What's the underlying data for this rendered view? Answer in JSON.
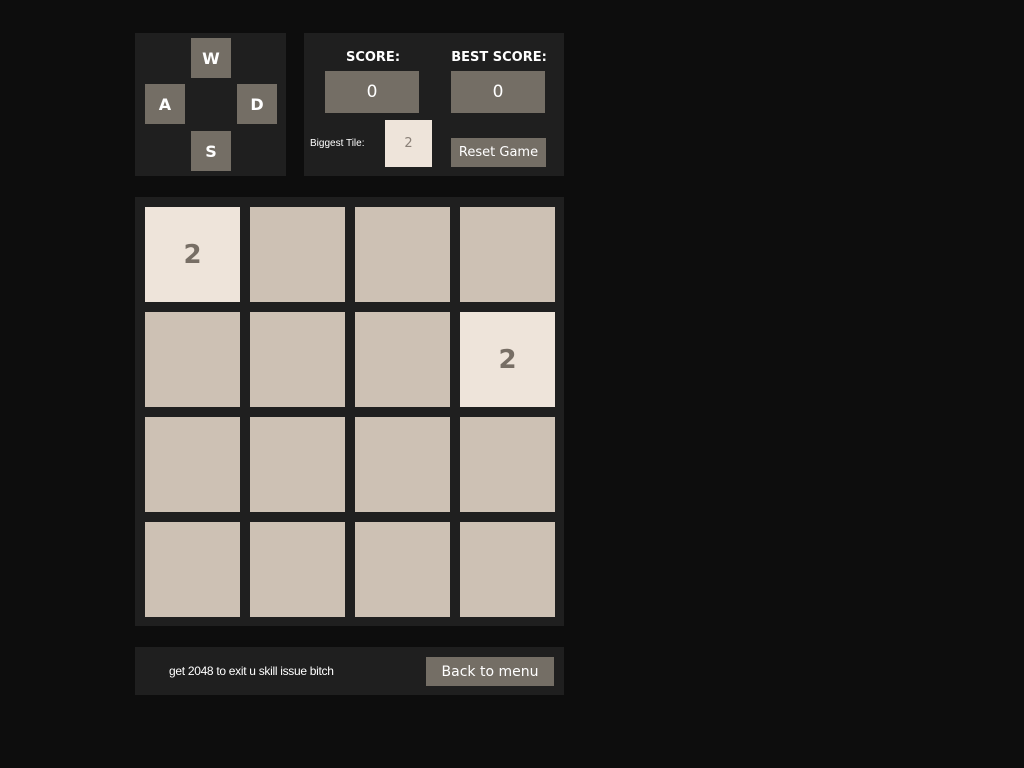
{
  "controls": {
    "up": "W",
    "left": "A",
    "right": "D",
    "down": "S"
  },
  "scores": {
    "score_label": "SCORE:",
    "score_value": "0",
    "best_label": "BEST SCORE:",
    "best_value": "0",
    "biggest_tile_label": "Biggest Tile:",
    "biggest_tile_value": "2",
    "reset_label": "Reset Game"
  },
  "board": {
    "rows": [
      [
        "2",
        "",
        "",
        ""
      ],
      [
        "",
        "",
        "",
        "2"
      ],
      [
        "",
        "",
        "",
        ""
      ],
      [
        "",
        "",
        "",
        ""
      ]
    ]
  },
  "footer": {
    "message": "get 2048 to exit u skill issue bitch",
    "back_label": "Back to menu"
  },
  "colors": {
    "background": "#0d0d0d",
    "panel": "#1f1f1f",
    "button": "#746e65",
    "empty_tile": "#cdc1b4",
    "tile_2": "#eee4da",
    "tile_text": "#776e65"
  }
}
